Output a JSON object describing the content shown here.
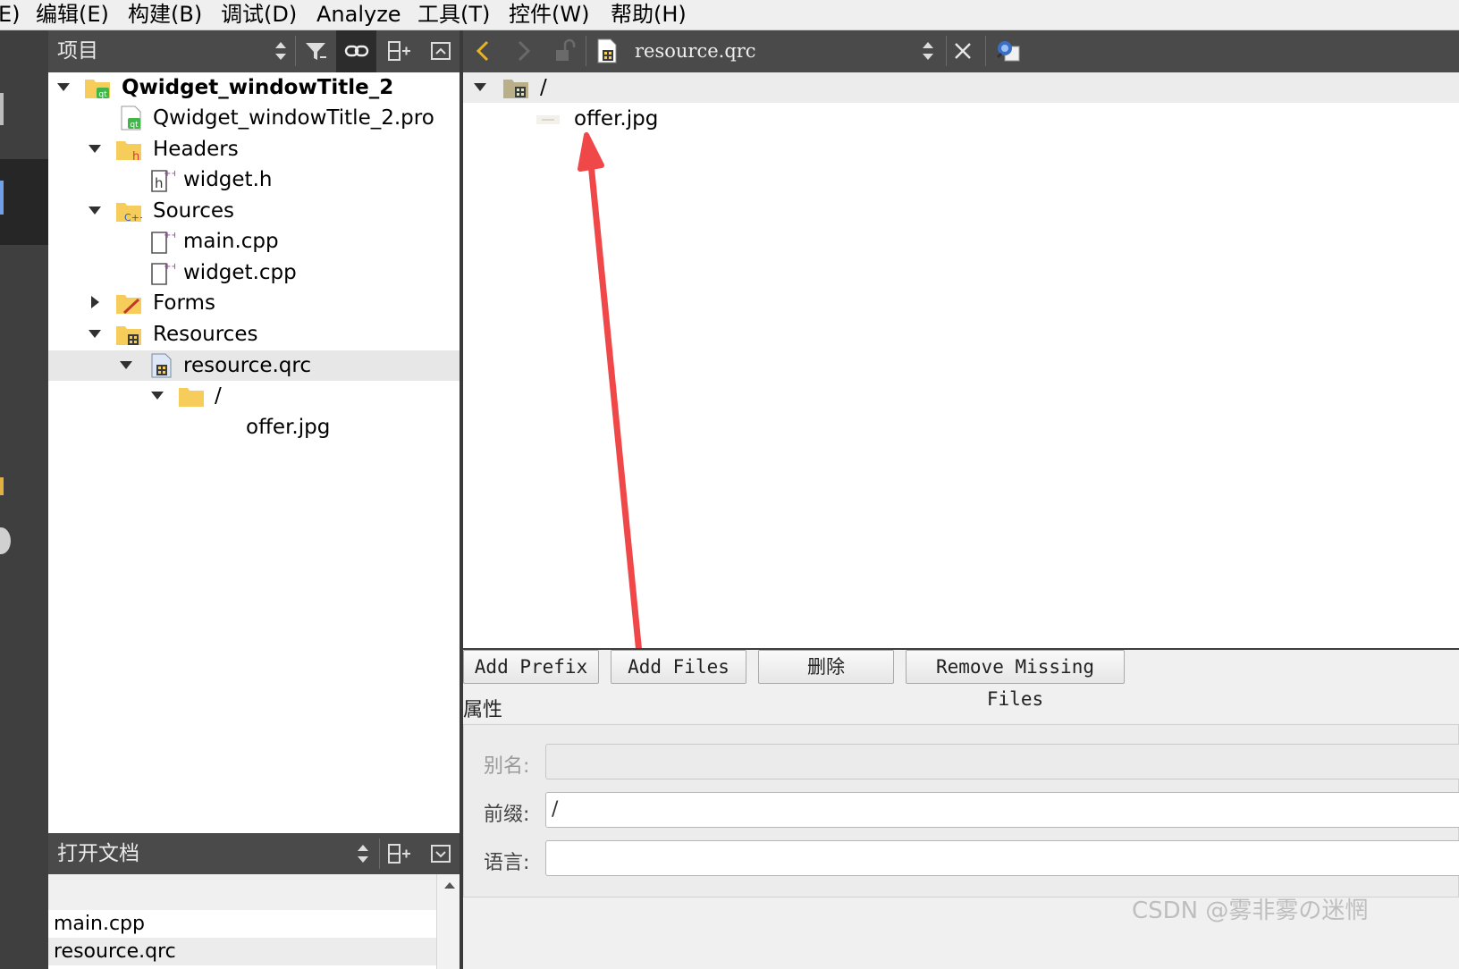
{
  "menubar": {
    "items": [
      "E)",
      "编辑(E)",
      "构建(B)",
      "调试(D)",
      "Analyze",
      "工具(T)",
      "控件(W)",
      "帮助(H)"
    ]
  },
  "project_panel": {
    "title": "项目",
    "tree": [
      {
        "label": "Qwidget_windowTitle_2",
        "icon": "qt-project-folder-icon",
        "bold": true,
        "expanded": true
      },
      {
        "label": "Qwidget_windowTitle_2.pro",
        "icon": "pro-file-icon"
      },
      {
        "label": "Headers",
        "icon": "headers-folder-icon",
        "expanded": true
      },
      {
        "label": "widget.h",
        "icon": "header-file-icon"
      },
      {
        "label": "Sources",
        "icon": "sources-folder-icon",
        "expanded": true
      },
      {
        "label": "main.cpp",
        "icon": "cpp-file-icon"
      },
      {
        "label": "widget.cpp",
        "icon": "cpp-file-icon"
      },
      {
        "label": "Forms",
        "icon": "forms-folder-icon",
        "expanded": false
      },
      {
        "label": "Resources",
        "icon": "resources-folder-icon",
        "expanded": true
      },
      {
        "label": "resource.qrc",
        "icon": "qrc-file-icon",
        "expanded": true,
        "selected": true
      },
      {
        "label": "/",
        "icon": "folder-icon",
        "expanded": true
      },
      {
        "label": "offer.jpg",
        "icon": "none"
      }
    ]
  },
  "open_docs": {
    "title": "打开文档",
    "items": [
      "main.cpp",
      "resource.qrc"
    ]
  },
  "editor": {
    "file_name": "resource.qrc",
    "tree_root": "/",
    "tree_child": "offer.jpg"
  },
  "buttons": {
    "add_prefix": "Add Prefix",
    "add_files": "Add Files",
    "delete": "删除",
    "remove_missing": "Remove Missing Files"
  },
  "properties": {
    "title": "属性",
    "alias_label": "别名:",
    "alias_value": "",
    "prefix_label": "前缀:",
    "prefix_value": "/",
    "language_label": "语言:",
    "language_value": ""
  },
  "watermark": "CSDN @雾非雾の迷惘",
  "colors": {
    "arrow": "#f04848",
    "dark_panel": "#4a4a4a",
    "mode_bar": "#3f3f3f"
  }
}
